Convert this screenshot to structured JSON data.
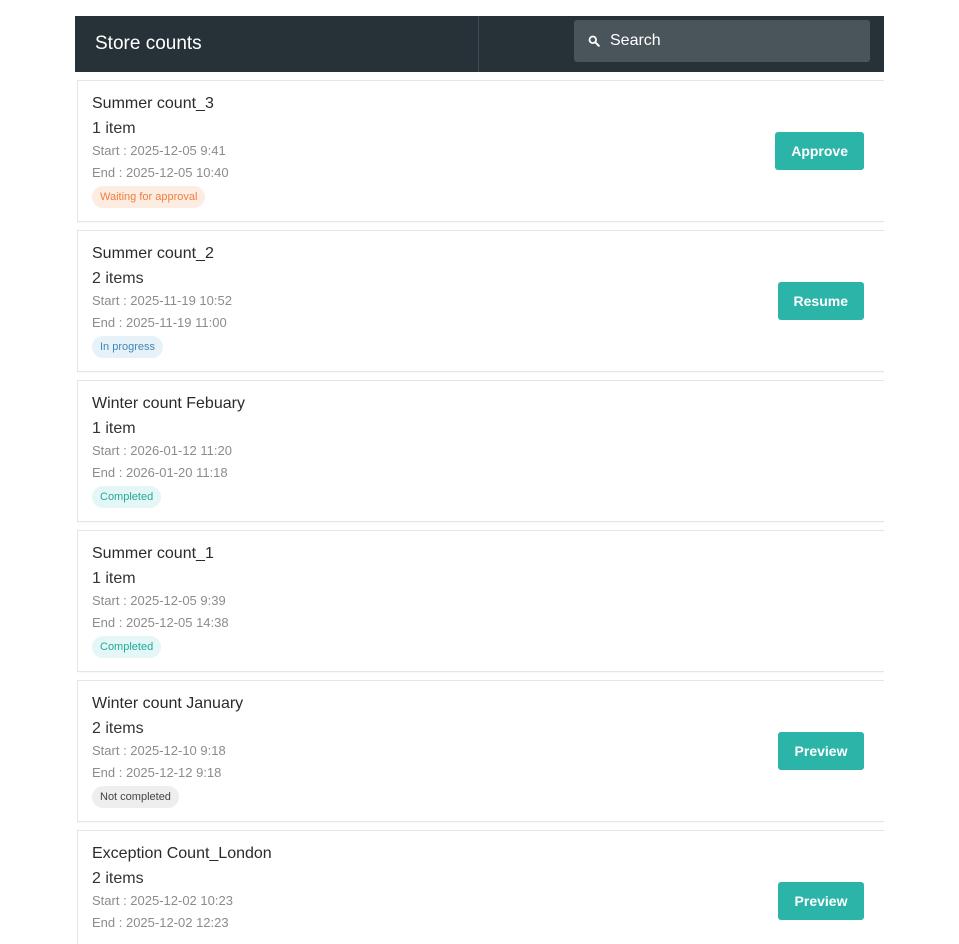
{
  "header": {
    "title": "Store counts",
    "search": {
      "placeholder": "Search",
      "icon": "search-icon"
    }
  },
  "colors": {
    "header_bg": "#263238",
    "search_bg": "#4a555b",
    "button": "#2bb5a8"
  },
  "counts": [
    {
      "title": "Summer count_3",
      "items": "1 item",
      "start": "Start : 2025-12-05 9:41",
      "end": "End : 2025-12-05 10:40",
      "status": "Waiting for approval",
      "action": "Approve"
    },
    {
      "title": "Summer count_2",
      "items": "2 items",
      "start": "Start : 2025-11-19 10:52",
      "end": "End : 2025-11-19 11:00",
      "status": "In progress",
      "action": "Resume"
    },
    {
      "title": "Winter count Febuary",
      "items": "1 item",
      "start": "Start : 2026-01-12 11:20",
      "end": "End : 2026-01-20 11:18",
      "status": "Completed",
      "action": ""
    },
    {
      "title": "Summer count_1",
      "items": "1 item",
      "start": "Start : 2025-12-05 9:39",
      "end": "End : 2025-12-05 14:38",
      "status": "Completed",
      "action": ""
    },
    {
      "title": "Winter count January",
      "items": "2 items",
      "start": "Start : 2025-12-10 9:18",
      "end": "End : 2025-12-12 9:18",
      "status": "Not completed",
      "action": "Preview"
    },
    {
      "title": "Exception Count_London",
      "items": "2 items",
      "start": "Start : 2025-12-02 10:23",
      "end": "End : 2025-12-02 12:23",
      "status": "",
      "action": "Preview"
    }
  ]
}
